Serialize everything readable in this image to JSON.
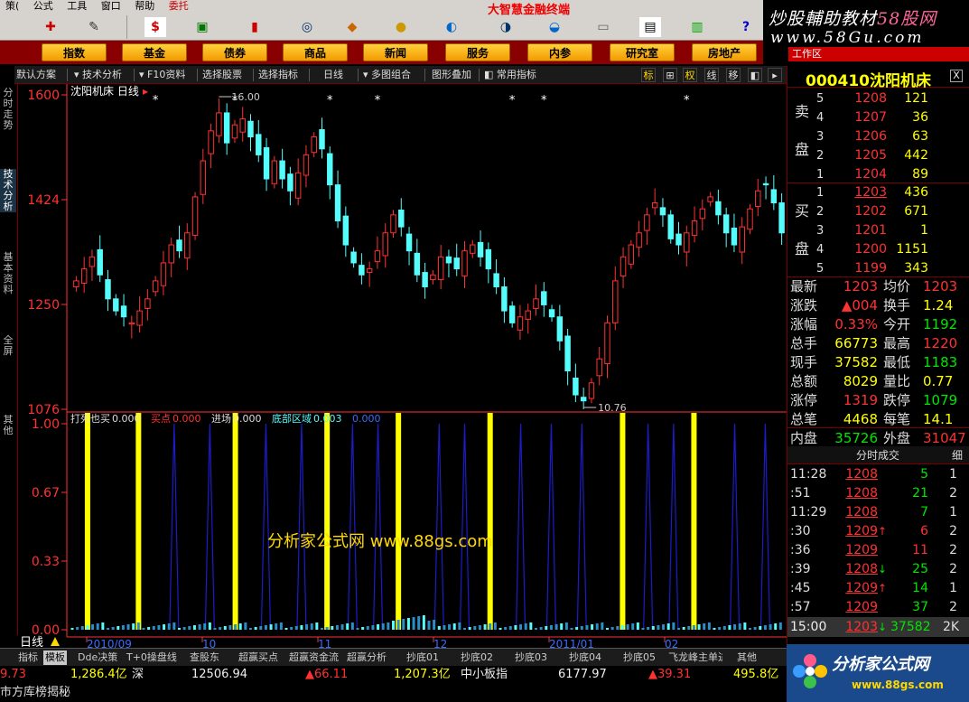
{
  "menu": [
    "策(",
    "公式",
    "工具",
    "窗口",
    "帮助",
    "委托"
  ],
  "toolbar_icons": [
    "cross-icon",
    "ruler-icon",
    "dollar-icon",
    "money-icon",
    "candlestick-icon",
    "binoculars-icon",
    "diamond-icon",
    "coin-icon",
    "globe-icon",
    "stock-icon",
    "window-icon",
    "bars-icon",
    "help-icon"
  ],
  "toolbar_brand": "大智慧金融终端",
  "brand": {
    "line1": "炒股輔助教材",
    "line1_num": "58股网",
    "line2": "www.58Gu.com",
    "line3": "工作区"
  },
  "categories": [
    "指数",
    "基金",
    "债券",
    "商品",
    "新闻",
    "服务",
    "内参",
    "研究室",
    "房地产"
  ],
  "viewbar": {
    "items": [
      "默认方案",
      "技术分析",
      "F10资料",
      "选择股票",
      "选择指标",
      "日线",
      "多图组合",
      "图形叠加",
      "常用指标"
    ],
    "right": [
      "标",
      "⊞",
      "权",
      "线",
      "移",
      "◧",
      "▸"
    ]
  },
  "left_tabs": [
    "分时走势",
    "技术分析",
    "基本资料",
    "全屏",
    "其他"
  ],
  "stock": {
    "code": "000410",
    "name": "沈阳机床",
    "period": "日线",
    "close_button": "X"
  },
  "colors": {
    "up": "#ff3232",
    "down": "#54fcfc",
    "yellow": "#ffff00",
    "blue": "#1c1cc8",
    "grid": "#7a0000",
    "axis": "#ff3232"
  },
  "chart_data": [
    {
      "type": "candlestick",
      "title": "沈阳机床 日线",
      "ylim": [
        10.76,
        16.0
      ],
      "y_ticks": [
        "1600",
        "1424",
        "1250",
        "1076"
      ],
      "x_ticks": [
        "2010/09",
        "10",
        "11",
        "12",
        "2011/01",
        "02"
      ],
      "annotations": {
        "high": "16.00",
        "low": "10.76"
      },
      "close": [
        12.9,
        13.1,
        13.3,
        13.0,
        12.6,
        12.4,
        12.3,
        12.2,
        12.4,
        12.6,
        12.9,
        13.2,
        13.5,
        13.4,
        13.7,
        14.3,
        14.9,
        15.4,
        15.7,
        15.2,
        15.5,
        15.6,
        15.3,
        15.0,
        14.6,
        14.9,
        14.6,
        14.4,
        14.7,
        15.0,
        15.3,
        15.1,
        14.5,
        13.9,
        13.5,
        13.2,
        13.0,
        13.1,
        13.4,
        13.7,
        14.0,
        13.8,
        13.4,
        13.0,
        12.8,
        13.0,
        13.3,
        13.2,
        13.1,
        13.4,
        13.5,
        13.3,
        13.1,
        12.8,
        12.4,
        12.2,
        12.3,
        12.4,
        12.6,
        12.5,
        12.3,
        11.9,
        11.4,
        11.0,
        10.9,
        11.2,
        11.6,
        12.2,
        12.9,
        13.3,
        13.5,
        13.7,
        14.0,
        14.2,
        14.0,
        13.6,
        13.5,
        13.7,
        13.9,
        14.1,
        14.3,
        14.0,
        13.7,
        13.5,
        13.8,
        14.1,
        14.4,
        14.5,
        14.2,
        13.7
      ],
      "signals": {
        "buy_star_indices": [
          10,
          20,
          32,
          38,
          55,
          59,
          77
        ]
      }
    },
    {
      "type": "indicator",
      "title": "打死也买",
      "series": [
        {
          "name": "打死也买",
          "value_text": "0.000"
        },
        {
          "name": "买点",
          "value_text": "0.000"
        },
        {
          "name": "进场",
          "value_text": "0.000"
        },
        {
          "name": "底部区域",
          "value_text": "0.003"
        },
        {
          "name": "",
          "value_text": "0.000"
        }
      ],
      "ylim": [
        0.0,
        1.0
      ],
      "y_ticks": [
        "1.00",
        "0.67",
        "0.33",
        "0.00"
      ],
      "yellow_bars_at": [
        3,
        13,
        32,
        50,
        64,
        82,
        108,
        122
      ],
      "blue_peaks_at": [
        20,
        27,
        38,
        45,
        55,
        60,
        72,
        77,
        88,
        94,
        100,
        113,
        118,
        130,
        136
      ],
      "watermark": "分析家公式网 www.88gs.com"
    }
  ],
  "order_book": {
    "sell_label": [
      "卖",
      "盘"
    ],
    "buy_label": [
      "买",
      "盘"
    ],
    "asks": [
      {
        "level": "5",
        "price": "1208",
        "vol": "121"
      },
      {
        "level": "4",
        "price": "1207",
        "vol": "36"
      },
      {
        "level": "3",
        "price": "1206",
        "vol": "63"
      },
      {
        "level": "2",
        "price": "1205",
        "vol": "442"
      },
      {
        "level": "1",
        "price": "1204",
        "vol": "89"
      }
    ],
    "bids": [
      {
        "level": "1",
        "price": "1203",
        "vol": "436"
      },
      {
        "level": "2",
        "price": "1202",
        "vol": "671"
      },
      {
        "level": "3",
        "price": "1201",
        "vol": "1"
      },
      {
        "level": "4",
        "price": "1200",
        "vol": "1151"
      },
      {
        "level": "5",
        "price": "1199",
        "vol": "343"
      }
    ]
  },
  "stats": [
    {
      "k1": "最新",
      "v1": "1203",
      "c1": "red",
      "k2": "均价",
      "v2": "1203",
      "c2": "red"
    },
    {
      "k1": "涨跌",
      "v1": "▲004",
      "c1": "red",
      "k2": "换手",
      "v2": "1.24",
      "c2": "yellow"
    },
    {
      "k1": "涨幅",
      "v1": "0.33%",
      "c1": "red",
      "k2": "今开",
      "v2": "1192",
      "c2": "green"
    },
    {
      "k1": "总手",
      "v1": "66773",
      "c1": "yellow",
      "k2": "最高",
      "v2": "1220",
      "c2": "red"
    },
    {
      "k1": "现手",
      "v1": "37582",
      "c1": "yellow",
      "k2": "最低",
      "v2": "1183",
      "c2": "green"
    },
    {
      "k1": "总额",
      "v1": "8029",
      "c1": "yellow",
      "k2": "量比",
      "v2": "0.77",
      "c2": "yellow"
    },
    {
      "k1": "涨停",
      "v1": "1319",
      "c1": "red",
      "k2": "跌停",
      "v2": "1079",
      "c2": "green"
    },
    {
      "k1": "总笔",
      "v1": "4468",
      "c1": "yellow",
      "k2": "每笔",
      "v2": "14.1",
      "c2": "yellow"
    },
    {
      "k1": "内盘",
      "v1": "35726",
      "c1": "green",
      "k2": "外盘",
      "v2": "31047",
      "c2": "red"
    }
  ],
  "ticks_header": {
    "title": "分时成交",
    "right": "细"
  },
  "ticks": [
    {
      "t": "11:28",
      "p": "1208",
      "a": "",
      "v": "5",
      "vc": "green",
      "n": "1"
    },
    {
      "t": ":51",
      "p": "1208",
      "a": "",
      "v": "21",
      "vc": "green",
      "n": "2"
    },
    {
      "t": "11:29",
      "p": "1208",
      "a": "",
      "v": "7",
      "vc": "green",
      "n": "1"
    },
    {
      "t": ":30",
      "p": "1209",
      "a": "↑",
      "v": "6",
      "vc": "red",
      "n": "2"
    },
    {
      "t": ":36",
      "p": "1209",
      "a": "",
      "v": "11",
      "vc": "red",
      "n": "2"
    },
    {
      "t": ":39",
      "p": "1208",
      "a": "↓",
      "v": "25",
      "vc": "green",
      "n": "2"
    },
    {
      "t": ":45",
      "p": "1209",
      "a": "↑",
      "v": "14",
      "vc": "green",
      "n": "1"
    },
    {
      "t": ":57",
      "p": "1209",
      "a": "",
      "v": "37",
      "vc": "green",
      "n": "2"
    }
  ],
  "ticks_footer": {
    "t": "15:00",
    "p": "1203",
    "a": "↓",
    "v": "37582",
    "n": "2K"
  },
  "bottom_tabs": [
    "指标",
    "模板",
    "Dde决策",
    "T+0操盘线",
    "查股东",
    "超赢买点",
    "超赢资金流",
    "超赢分析",
    "抄底01",
    "抄底02",
    "抄底03",
    "抄底04",
    "抄底05",
    "飞龙峰主单进",
    "其他"
  ],
  "bottom_period": "日线",
  "ticker": [
    {
      "text": "9.73",
      "c": "red"
    },
    {
      "text": "1,286.4亿",
      "c": "yellow"
    },
    {
      "text": "深",
      "c": "white"
    },
    {
      "text": "12506.94",
      "c": "white"
    },
    {
      "text": "▲66.11",
      "c": "red"
    },
    {
      "text": "1,207.3亿",
      "c": "yellow"
    },
    {
      "text": "中小板指",
      "c": "white"
    },
    {
      "text": "6177.97",
      "c": "white"
    },
    {
      "text": "▲39.31",
      "c": "red"
    },
    {
      "text": "495.8亿",
      "c": "yellow"
    }
  ],
  "scroller": "市方库榜揭秘",
  "logo": {
    "name": "分析家公式网",
    "url": "www.88gs.com"
  }
}
